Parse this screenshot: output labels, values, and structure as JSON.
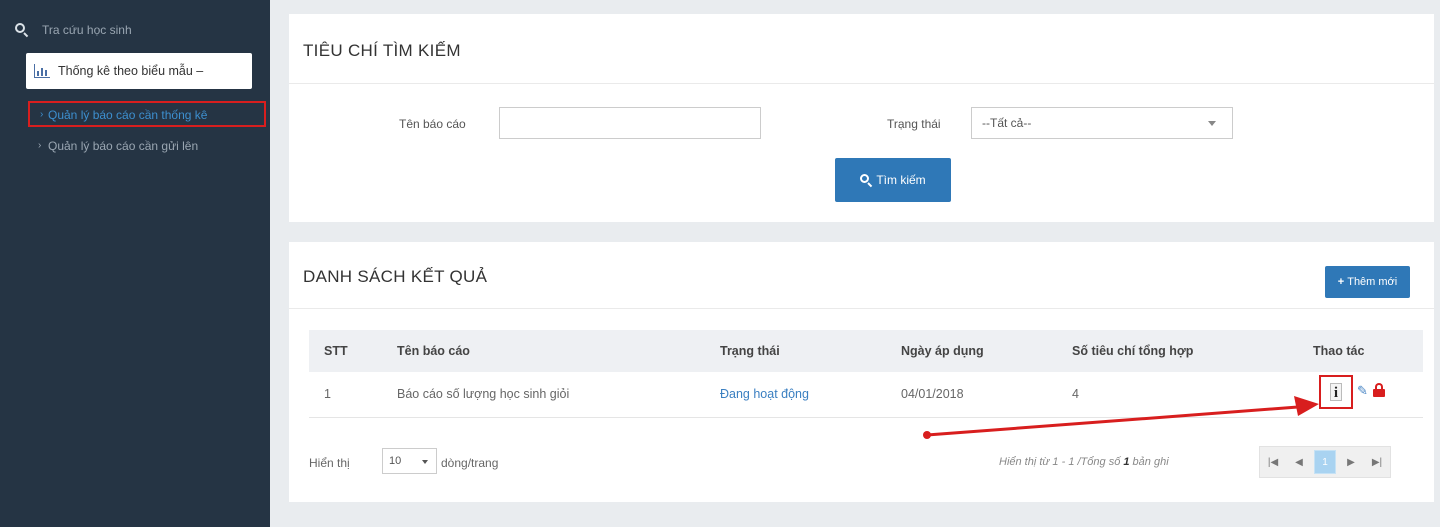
{
  "sidebar": {
    "search_label": "Tra cứu học sinh",
    "active_item": "Thống kê theo biểu mẫu  –",
    "sub_items": [
      {
        "label": "Quản lý báo cáo cần thống kê"
      },
      {
        "label": "Quản lý báo cáo cần gửi lên"
      }
    ]
  },
  "search_panel": {
    "title": "TIÊU CHÍ TÌM KIẾM",
    "report_name_label": "Tên báo cáo",
    "report_name_value": "",
    "status_label": "Trạng thái",
    "status_value": "--Tất cả--",
    "search_button": "Tìm kiếm"
  },
  "results_panel": {
    "title": "DANH SÁCH KẾT QUẢ",
    "add_button": "Thêm mới",
    "columns": [
      "STT",
      "Tên báo cáo",
      "Trạng thái",
      "Ngày áp dụng",
      "Số tiêu chí tổng hợp",
      "Thao tác"
    ],
    "rows": [
      {
        "stt": "1",
        "name": "Báo cáo số lượng học sinh giỏi",
        "status": "Đang hoạt động",
        "date": "04/01/2018",
        "criteria": "4"
      }
    ],
    "footer": {
      "show_label": "Hiển thị",
      "page_size": "10",
      "per_page_label": "dòng/trang",
      "summary_prefix": "Hiển thị từ 1 - 1 /Tổng số ",
      "summary_total": "1",
      "summary_suffix": " bản ghi",
      "current_page": "1"
    }
  },
  "colors": {
    "sidebar_bg": "#253444",
    "primary": "#2f78b7",
    "annotation_red": "#d81e1e"
  }
}
